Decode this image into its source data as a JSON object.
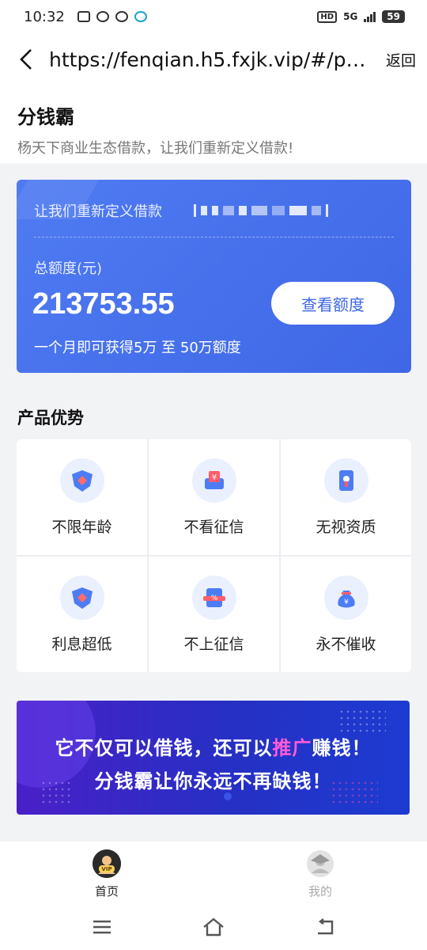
{
  "status_bar": {
    "time": "10:32",
    "hd": "HD",
    "network": "5G",
    "battery": "59"
  },
  "nav": {
    "url": "https://fenqian.h5.fxjk.vip/#/pag…",
    "return_label": "返回"
  },
  "header": {
    "title": "分钱霸",
    "subtitle": "杨天下商业生态借款，让我们重新定义借款!"
  },
  "credit_card": {
    "slogan": "让我们重新定义借款",
    "amount_label": "总额度(元)",
    "amount": "213753.55",
    "view_button": "查看额度",
    "note": "一个月即可获得5万 至 50万额度"
  },
  "advantages": {
    "title": "产品优势",
    "items": [
      {
        "label": "不限年龄",
        "icon": "shield-icon"
      },
      {
        "label": "不看征信",
        "icon": "yuan-card-icon"
      },
      {
        "label": "无视资质",
        "icon": "document-icon"
      },
      {
        "label": "利息超低",
        "icon": "shield-icon"
      },
      {
        "label": "不上征信",
        "icon": "percent-icon"
      },
      {
        "label": "永不催收",
        "icon": "money-bag-icon"
      }
    ]
  },
  "banner": {
    "line1_a": "它不仅可以借钱，",
    "line1_b": "还可以",
    "line1_highlight": "推广",
    "line1_c": "赚钱！",
    "line2": "分钱霸让你永远不再缺钱！"
  },
  "tabs": [
    {
      "label": "首页",
      "icon": "vip-avatar-icon",
      "active": true
    },
    {
      "label": "我的",
      "icon": "profile-icon",
      "active": false
    }
  ],
  "colors": {
    "card_blue": "#4472ee",
    "banner_purple": "#3a27c8",
    "highlight_pink": "#ff5bd6"
  }
}
